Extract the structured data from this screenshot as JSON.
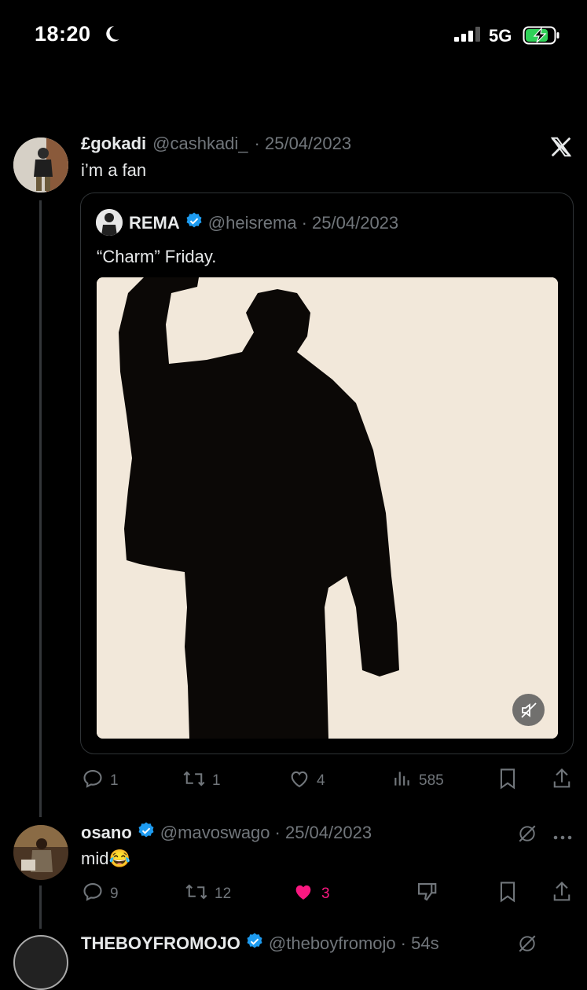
{
  "status_bar": {
    "time": "18:20",
    "network": "5G"
  },
  "colors": {
    "background": "#000000",
    "text": "#e7e9ea",
    "muted": "#71767b",
    "verified": "#1d9bf0",
    "like": "#f91880"
  },
  "tweets": [
    {
      "display_name": "£gokadi",
      "handle": "@cashkadi_",
      "date": "· 25/04/2023",
      "text": "i’m a fan",
      "quote": {
        "display_name": "REMA",
        "handle": "@heisrema",
        "date": "· 25/04/2023",
        "text": "“Charm” Friday."
      },
      "actions": {
        "replies": "1",
        "reposts": "1",
        "likes": "4",
        "views": "585"
      }
    },
    {
      "display_name": "osano",
      "handle": "@mavoswago",
      "date": "· 25/04/2023",
      "text": "mid😂",
      "actions": {
        "replies": "9",
        "reposts": "12",
        "likes": "3"
      }
    },
    {
      "display_name": "THEBOYFROMOJO",
      "handle": "@theboyfromojo",
      "date": "· 54s"
    }
  ]
}
